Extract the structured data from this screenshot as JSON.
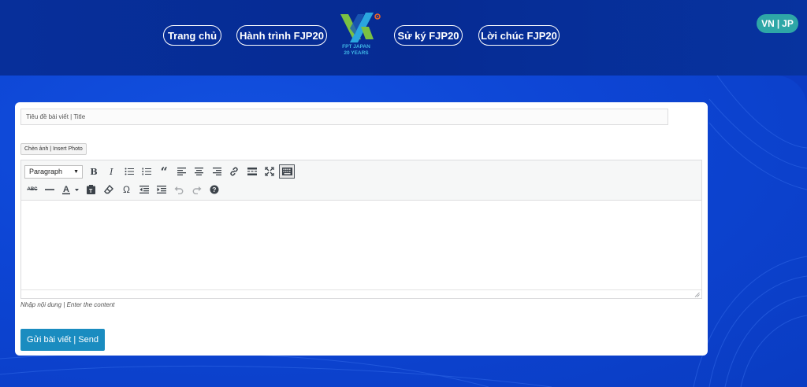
{
  "header": {
    "nav": [
      {
        "label": "Trang chủ"
      },
      {
        "label": "Hành trình FJP20"
      },
      {
        "label": "Sử ký FJP20"
      },
      {
        "label": "Lời chúc FJP20"
      }
    ],
    "logo": {
      "line1": "FPT JAPAN",
      "line2": "20 YEARS"
    },
    "lang": {
      "vn": "VN",
      "sep": "|",
      "jp": "JP"
    }
  },
  "form": {
    "title_placeholder": "Tiêu đề bài viết | Title",
    "insert_photo_label": "Chèn ảnh | Insert Photo",
    "format_select_value": "Paragraph",
    "content_hint": "Nhập nội dung | Enter the content",
    "send_label": "Gửi bài viết | Send"
  },
  "toolbar_icons": {
    "row1": [
      "bold-icon",
      "italic-icon",
      "bullet-list-icon",
      "numbered-list-icon",
      "blockquote-icon",
      "align-left-icon",
      "align-center-icon",
      "align-right-icon",
      "link-icon",
      "read-more-icon",
      "fullscreen-icon",
      "toolbar-toggle-icon"
    ],
    "row2": [
      "strikethrough-icon",
      "horizontal-line-icon",
      "text-color-icon",
      "paste-text-icon",
      "clear-formatting-icon",
      "special-character-icon",
      "outdent-icon",
      "indent-icon",
      "undo-icon",
      "redo-icon",
      "help-icon"
    ]
  },
  "colors": {
    "header_bg": "#062b93",
    "page_bg": "#0d45d4",
    "lang_toggle": "#2ea7a7",
    "send_button": "#1a8cc0",
    "logo_green": "#7ac143",
    "logo_blue": "#2aa6df",
    "logo_orange": "#f26522"
  }
}
